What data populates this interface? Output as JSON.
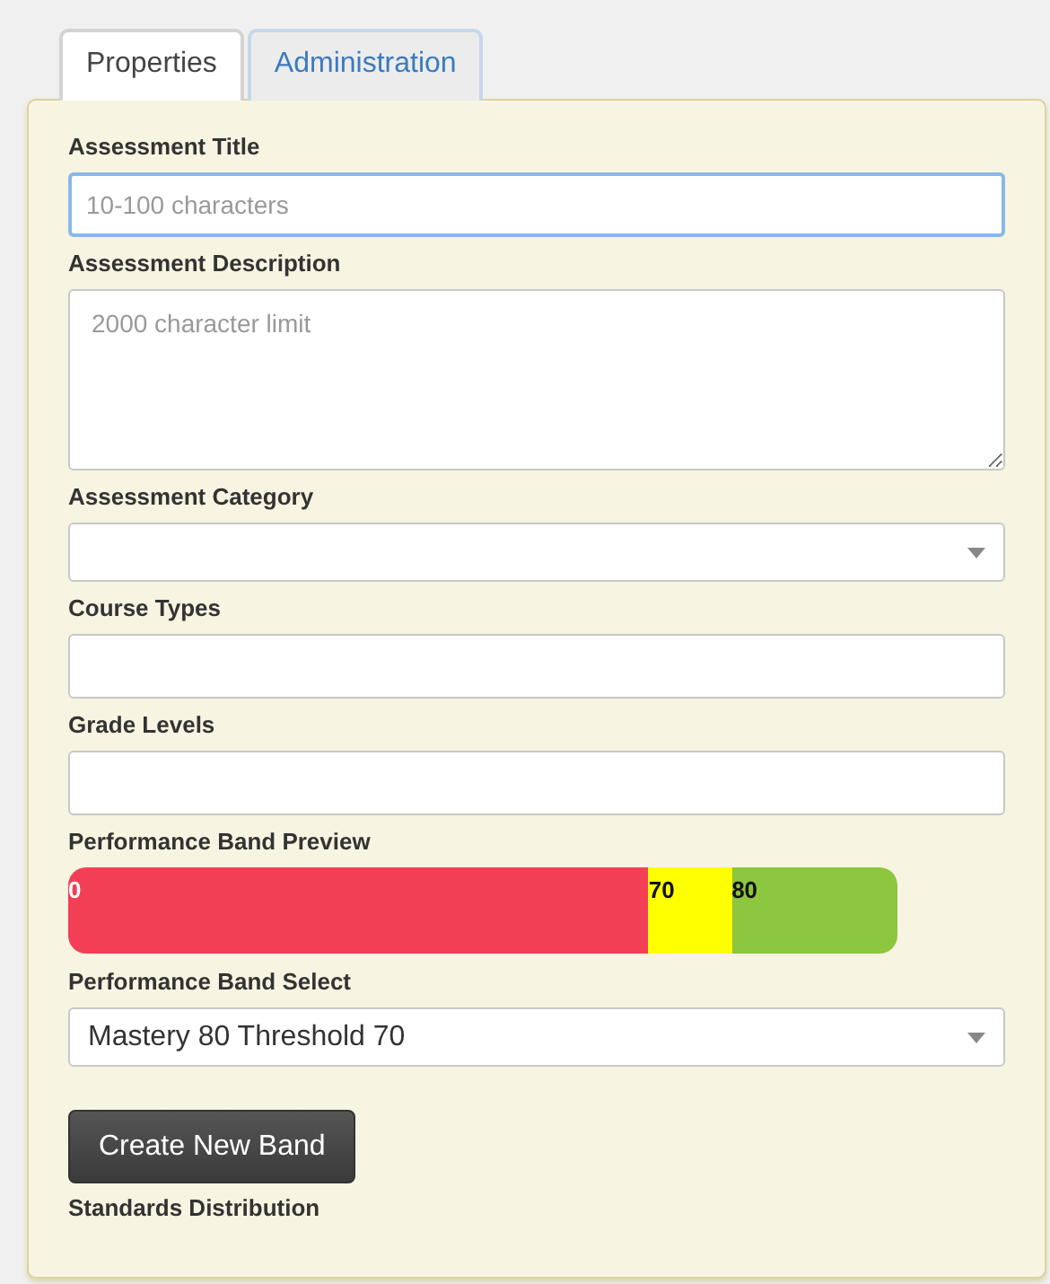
{
  "tabs": [
    {
      "label": "Properties",
      "selected": true
    },
    {
      "label": "Administration",
      "selected": false
    }
  ],
  "fields": [
    {
      "kind": "text",
      "label": "Assessment Title",
      "placeholder": "10-100 characters",
      "focused": true
    },
    {
      "kind": "textarea",
      "label": "Assessment Description",
      "placeholder": "2000 character limit",
      "focused": false
    },
    {
      "kind": "select",
      "label": "Assessment Category"
    },
    {
      "kind": "text",
      "label": "Course Types",
      "focused": false
    },
    {
      "kind": "text",
      "label": "Grade Levels",
      "focused": false
    },
    {
      "kind": "bands",
      "label": "Performance Band Preview",
      "bands": [
        {
          "label": "0",
          "color": "#f23f56"
        },
        {
          "label": "70",
          "color": "#ffff00"
        },
        {
          "label": "80",
          "color": "#8dc63f"
        }
      ]
    },
    {
      "kind": "select",
      "label": "Performance Band Select",
      "value": "Mastery 80 Threshold 70"
    }
  ],
  "button": "Create New Band",
  "footer_label": "Standards Distribution"
}
